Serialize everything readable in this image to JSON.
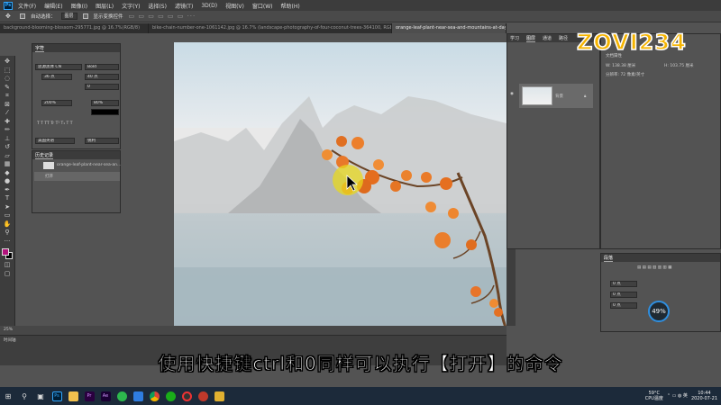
{
  "menubar": {
    "items": [
      "文件(F)",
      "编辑(E)",
      "图像(I)",
      "图层(L)",
      "文字(Y)",
      "选择(S)",
      "滤镜(T)",
      "3D(D)",
      "视图(V)",
      "窗口(W)",
      "帮助(H)"
    ]
  },
  "options": {
    "auto_select": "自动选择：",
    "group": "图层",
    "show_transform": "显示变换控件"
  },
  "tabs": [
    "background-blooming-blossom-295771.jpg @ 16.7%(RGB/8)",
    "bike-chain-number-one-1061142.jpg @ 16.7% (landscape-photography-of-four-coconut-trees-364100, RGB/8)",
    "orange-leaf-plant-near-sea-and-mountains-at-daytime-689491.jpg @ 25%(RGB/8)"
  ],
  "char_panel": {
    "title": "字符",
    "font": "思源黑体 CN",
    "style": "Bold",
    "size": "36 点",
    "leading": "40 点",
    "tracking": "0",
    "scale_v": "200%",
    "scale_h": "80%",
    "lang": "美国英语",
    "aa": "锐利"
  },
  "history_panel": {
    "title": "历史记录",
    "doc": "orange-leaf-plant-near-sea-an...",
    "step": "打开"
  },
  "layers_panel": {
    "tabs": [
      "学习",
      "图层",
      "通道",
      "路径"
    ],
    "layer_name": "背景"
  },
  "properties": {
    "title": "文档属性",
    "w": "W: 138.38 厘米",
    "h": "H: 103.75 厘米",
    "res": "分辨率: 72 像素/英寸"
  },
  "para_panel": {
    "title": "段落",
    "value": "0 点"
  },
  "status": {
    "zoom": "25%"
  },
  "timeline": {
    "title": "时间轴"
  },
  "logo": "ZOVI234",
  "subtitle": "使用快捷键ctrl和0同样可以执行【打开】的命令",
  "cpu": {
    "pct": "49%",
    "label": "CPU使用"
  },
  "tray": {
    "temp": "59°C",
    "temp_label": "CPU温度",
    "time": "10:44",
    "date": "2020-07-21"
  }
}
